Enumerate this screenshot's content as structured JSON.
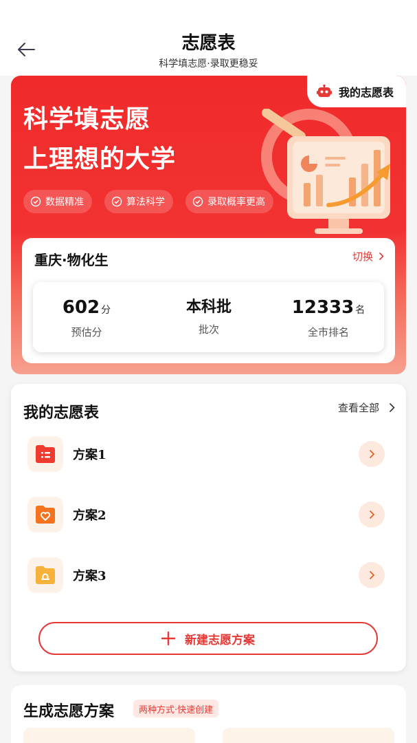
{
  "header": {
    "title": "志愿表",
    "subtitle": "科学填志愿·录取更稳妥"
  },
  "hero": {
    "line1": "科学填志愿",
    "line2": "上理想的大学",
    "my_wish_label": "我的志愿表",
    "pills": [
      "数据精准",
      "算法科学",
      "录取概率更高"
    ]
  },
  "profile": {
    "region": "重庆·物化生",
    "switch_label": "切换",
    "stats": {
      "score": {
        "value": "602",
        "unit": "分",
        "label": "预估分"
      },
      "batch": {
        "value": "本科批",
        "label": "批次"
      },
      "rank": {
        "value": "12333",
        "unit": "名",
        "label": "全市排名"
      }
    }
  },
  "wish_list": {
    "title": "我的志愿表",
    "view_all": "查看全部",
    "plans": [
      {
        "name": "方案1",
        "icon": "folder-list-icon",
        "color": "#ef3a2f"
      },
      {
        "name": "方案2",
        "icon": "folder-heart-icon",
        "color": "#f5731f"
      },
      {
        "name": "方案3",
        "icon": "folder-bell-icon",
        "color": "#f7b23b"
      }
    ],
    "new_plan_label": "新建志愿方案"
  },
  "generate": {
    "title": "生成志愿方案",
    "badge": "两种方式·快速创建"
  },
  "colors": {
    "brand_red": "#e53935",
    "hero_red": "#f02a2a"
  }
}
